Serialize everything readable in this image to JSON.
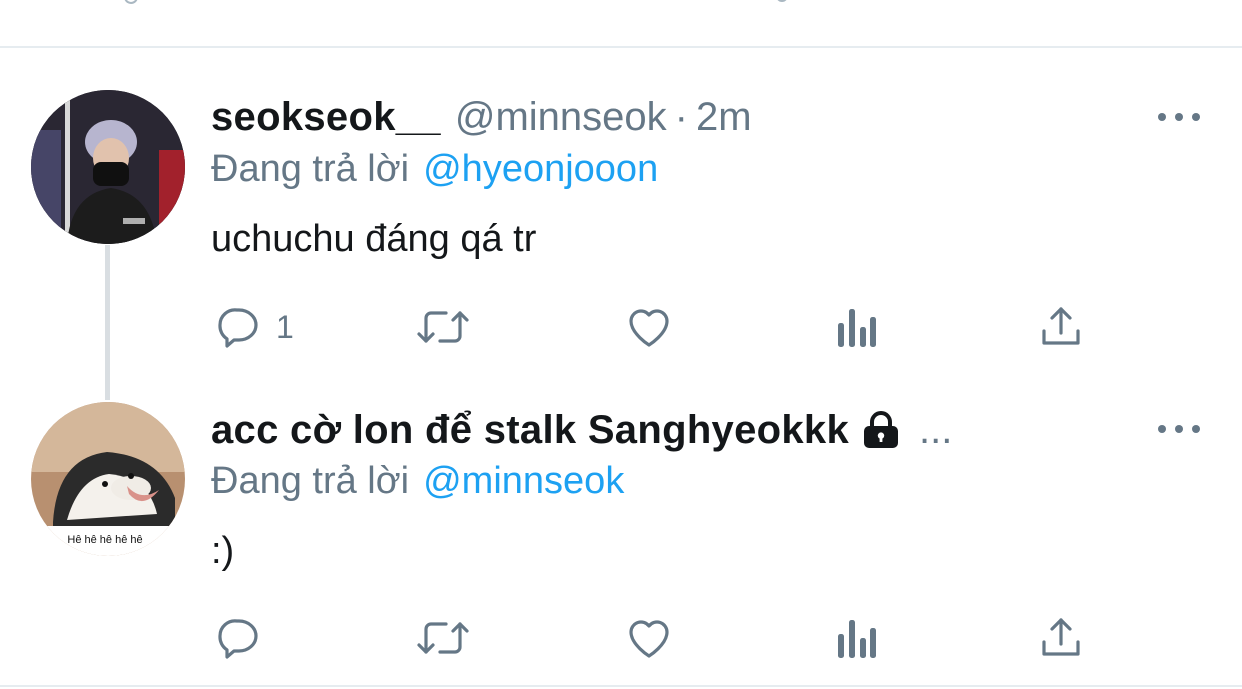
{
  "tweets": [
    {
      "name": "seokseok__",
      "handle": "@minnseok",
      "separator": "·",
      "time": "2m",
      "replying_label": "Đang trả lời",
      "replying_to": "@hyeonjooon",
      "text": "uchuchu đáng qá tr",
      "reply_count": "1"
    },
    {
      "name": "acc cờ lon để stalk Sanghyeokkk",
      "name_ellipsis": "...",
      "replying_label": "Đang trả lời",
      "replying_to": "@minnseok",
      "text": ":)",
      "avatar_caption": "Hê hê hê hê hê"
    }
  ],
  "colors": {
    "accent": "#1da1f2",
    "secondary_text": "#657786",
    "primary_text": "#14171a",
    "divider": "#e6ecf0"
  },
  "icons": [
    "comment-icon",
    "retweet-icon",
    "like-icon",
    "analytics-icon",
    "share-icon",
    "more-icon",
    "lock-icon"
  ]
}
